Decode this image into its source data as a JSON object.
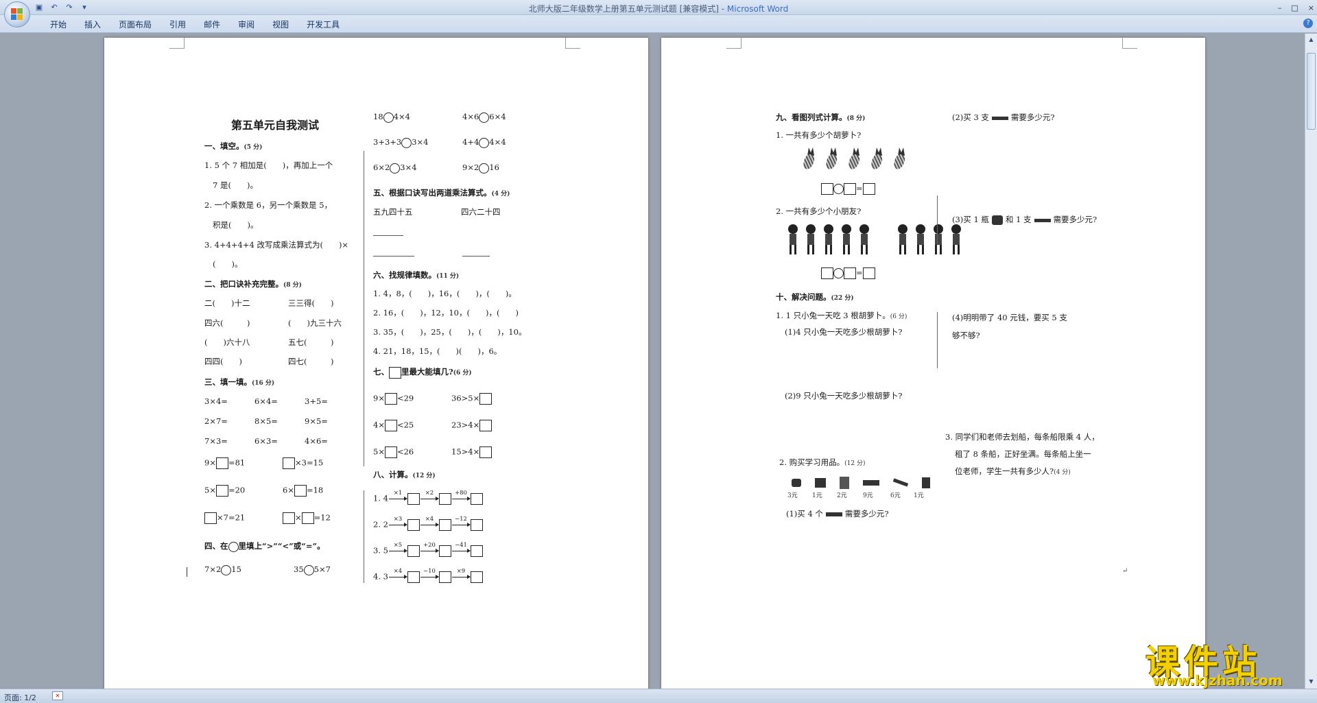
{
  "window": {
    "title": "北师大版二年级数学上册第五单元测试题 [兼容模式] - ",
    "app_name": "Microsoft Word",
    "minimize": "–",
    "maximize": "□",
    "close": "×"
  },
  "qat": {
    "save": "▣",
    "undo": "↶",
    "redo": "↷",
    "more": "▾"
  },
  "ribbon": {
    "tabs": [
      "开始",
      "插入",
      "页面布局",
      "引用",
      "邮件",
      "审阅",
      "视图",
      "开发工具"
    ],
    "help": "?"
  },
  "page1": {
    "title": "第五单元自我测试",
    "s1": "一、填空。",
    "s1_score": "(5 分)",
    "q1_1a": "1. 5 个 7 相加是(　　)，再加上一个",
    "q1_1b": "7 是(　　)。",
    "q1_2a": "2. 一个乘数是 6，另一个乘数是 5，",
    "q1_2b": "积是(　　)。",
    "q1_3a": "3. 4+4+4+4 改写成乘法算式为(　　)×",
    "q1_3b": "(　　)。",
    "s2": "二、把口诀补充完整。",
    "s2_score": "(8 分)",
    "s2_items": [
      "二(　　)十二",
      "三三得(　　)",
      "四六(　　　)",
      "(　　)九三十六",
      "(　　)六十八",
      "五七(　　　)",
      "四四(　　)",
      "四七(　　　)"
    ],
    "s3": "三、填一填。",
    "s3_score": "(16 分)",
    "s3_row1": [
      "3×4=",
      "6×4=",
      "3+5="
    ],
    "s3_row2": [
      "2×7=",
      "8×5=",
      "9×5="
    ],
    "s3_row3": [
      "7×3=",
      "6×3=",
      "4×6="
    ],
    "s3_box": [
      "=81",
      "×3=15",
      "=20",
      "=18",
      "×7=21",
      "=12"
    ],
    "s3_box_pre": [
      "9×",
      "5×",
      "6×"
    ],
    "s4": "四、在",
    "s4_b": "里填上“>”“<”或“=”。",
    "s4_row": [
      "7×2",
      "15",
      "35",
      "5×7"
    ],
    "c2_row1": [
      "18",
      "4×4",
      "4×6",
      "6×4"
    ],
    "c2_row2": [
      "3+3+3",
      "3×4",
      "4+4",
      "4×4"
    ],
    "c2_row3": [
      "6×2",
      "3×4",
      "9×2",
      "16"
    ],
    "s5": "五、根据口诀写出两道乘法算式。",
    "s5_score": "(4 分)",
    "s5_items": [
      "五九四十五",
      "四六二十四"
    ],
    "s6": "六、找规律填数。",
    "s6_score": "(11 分)",
    "s6_items": [
      "1. 4，8，(　　)，16，(　　)，(　　)。",
      "2. 16，(　　)，12，10，(　　)，(　　)",
      "3. 35，(　　)，25，(　　)，(　　)，10。",
      "4. 21，18，15，(　　)(　　)，6。"
    ],
    "s7": "七、",
    "s7_b": "里最大能填几?",
    "s7_score": "(6 分)",
    "s7_items": [
      "9×",
      "<29",
      "36>5×",
      "4×",
      "<25",
      "23>4×",
      "5×",
      "<26",
      "15>4×"
    ],
    "s8": "八、计算。",
    "s8_score": "(12 分)",
    "s8_rows": [
      {
        "n": "1. 4",
        "ops": [
          "×1",
          "×2",
          "+80"
        ]
      },
      {
        "n": "2. 2",
        "ops": [
          "×3",
          "×4",
          "−12"
        ]
      },
      {
        "n": "3. 5",
        "ops": [
          "×5",
          "+20",
          "−41"
        ]
      },
      {
        "n": "4. 3",
        "ops": [
          "×4",
          "−10",
          "×9"
        ]
      }
    ]
  },
  "page2": {
    "s9": "九、看图列式计算。",
    "s9_score": "(8 分)",
    "q9_1": "1. 一共有多少个胡萝卜?",
    "q9_2": "2. 一共有多少个小朋友?",
    "s10": "十、解决问题。",
    "s10_score": "(22 分)",
    "q10_1": "1. 1 只小兔一天吃 3 根胡萝卜。",
    "q10_1_score": "(6 分)",
    "q10_1a": "(1)4 只小兔一天吃多少根胡萝卜?",
    "q10_1b": "(2)9 只小兔一天吃多少根胡萝卜?",
    "q10_2": "2. 购买学习用品。",
    "q10_2_score": "(12 分)",
    "prices": [
      "3元",
      "1元",
      "2元",
      "9元",
      "6元",
      "1元"
    ],
    "q10_2a": "(1)买 4 个",
    "q10_2a_end": "需要多少元?",
    "q10_2b": "(2)买 3 支",
    "q10_2b_end": "需要多少元?",
    "q10_2c": "(3)买 1 瓶",
    "q10_2c_mid": "和 1 支",
    "q10_2c_end": "需要多少元?",
    "q10_2d1": "(4)明明带了 40 元钱，要买 5 支",
    "q10_2d2": "够不够?",
    "q10_3a": "3. 同学们和老师去划船，每条船限乘 4 人，",
    "q10_3b": "租了 8 条船，正好坐满。每条船上坐一",
    "q10_3c": "位老师，学生一共有多少人?",
    "q10_3_score": "(4 分)",
    "para_mark": "↵"
  },
  "status": {
    "page": "页面: 1/2"
  },
  "watermark": {
    "cn": "课件站",
    "url": "www.kjzhan.com"
  },
  "scroll": {
    "up": "▲",
    "down": "▼"
  }
}
